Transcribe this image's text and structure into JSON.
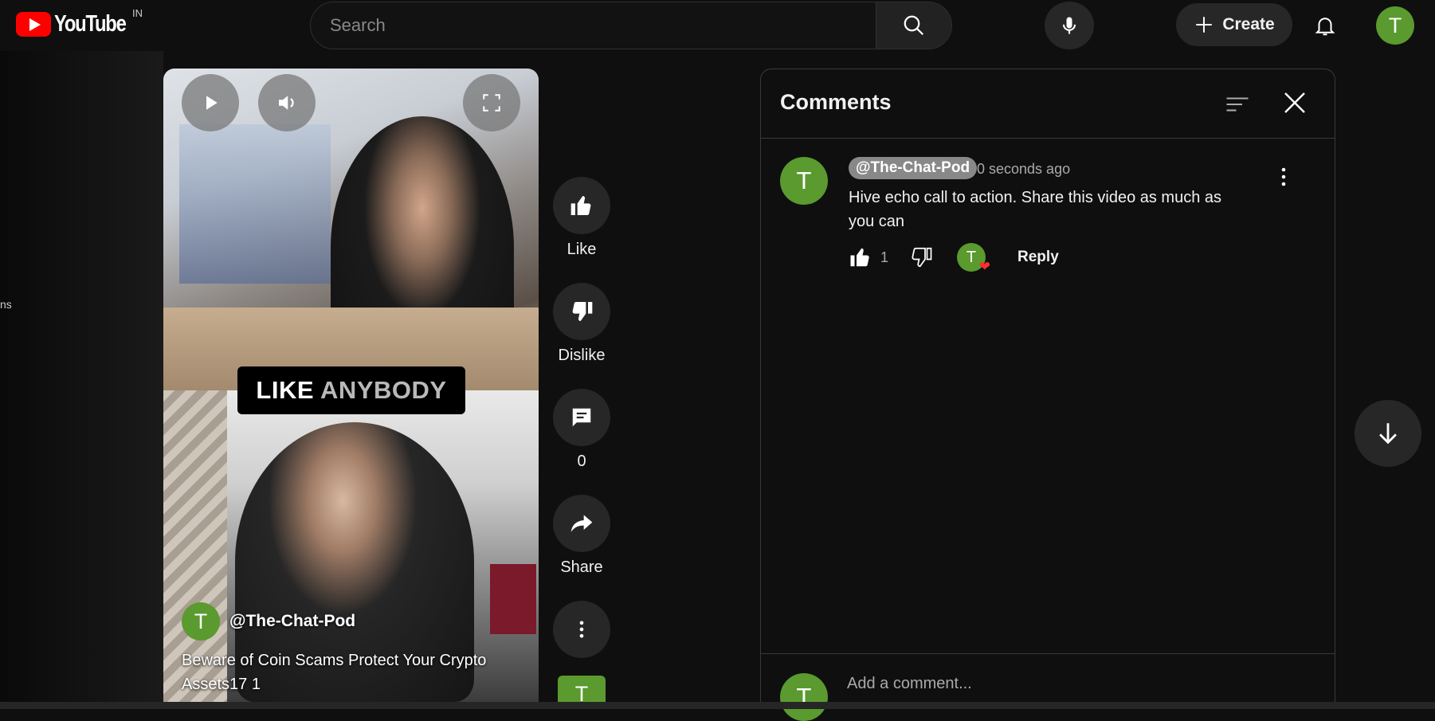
{
  "header": {
    "logo_text": "YouTube",
    "country_code": "IN",
    "search_placeholder": "Search",
    "create_label": "Create",
    "avatar_letter": "T"
  },
  "left_fragment": "ns",
  "video": {
    "caption_word1": "LIKE",
    "caption_word2": "ANYBODY",
    "channel_avatar_letter": "T",
    "channel_name": "@The-Chat-Pod",
    "title": "Beware of Coin Scams  Protect Your Crypto Assets17 1"
  },
  "actions": {
    "like_label": "Like",
    "dislike_label": "Dislike",
    "comments_count": "0",
    "share_label": "Share",
    "avatar_letter": "T"
  },
  "comments_panel": {
    "title": "Comments",
    "comment": {
      "avatar_letter": "T",
      "author": "@The-Chat-Pod",
      "time": "0 seconds ago",
      "text": "Hive echo call to action. Share this video as much as you can",
      "like_count": "1",
      "hearted_avatar_letter": "T",
      "reply_label": "Reply"
    },
    "footer_avatar_letter": "T",
    "add_placeholder": "Add a comment..."
  },
  "colors": {
    "background": "#0f0f0f",
    "brand_red": "#ff0000",
    "avatar_green": "#5a9a2e",
    "button_gray": "#272727"
  }
}
